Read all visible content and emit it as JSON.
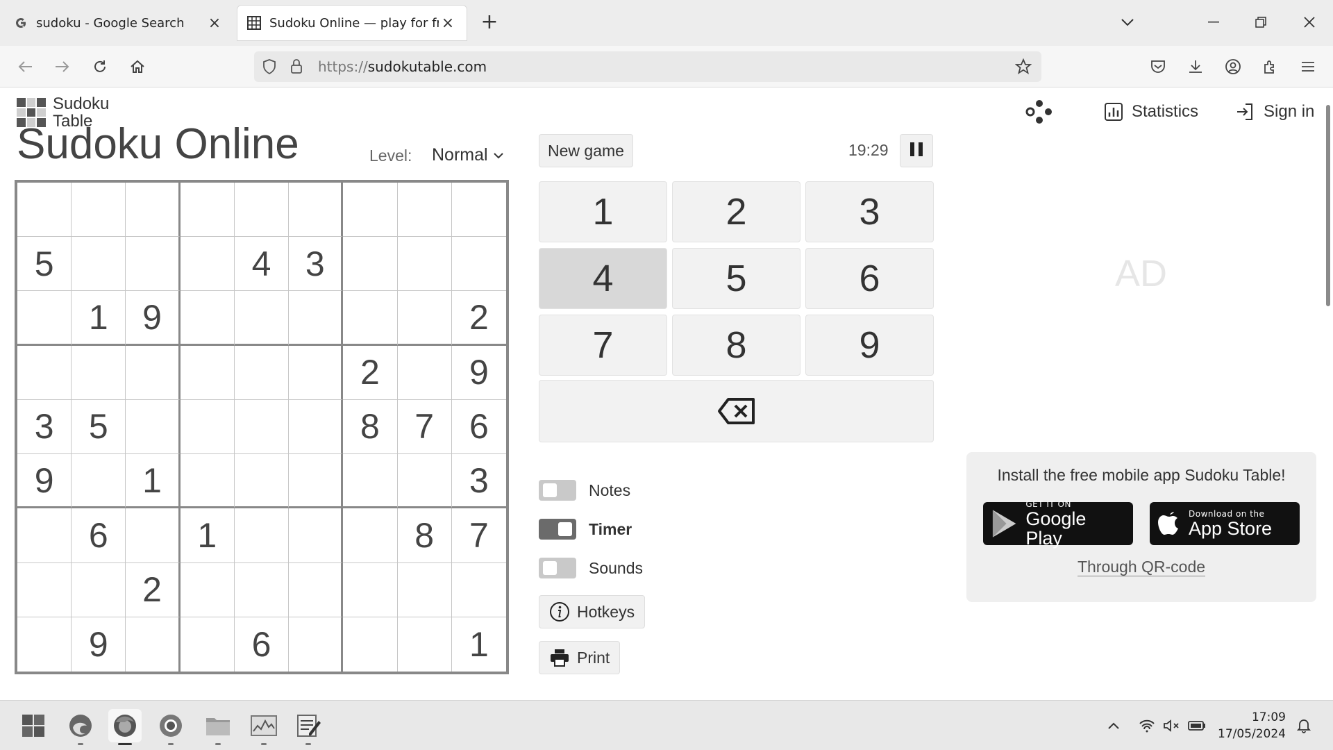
{
  "browser": {
    "tabs": [
      {
        "title": "sudoku - Google Search",
        "favicon": "google-g-icon"
      },
      {
        "title": "Sudoku Online — play for free online",
        "favicon": "sudoku-grid-icon"
      }
    ],
    "url_protocol": "https://",
    "url_host": "sudokutable.com"
  },
  "site": {
    "logo_line1": "Sudoku",
    "logo_line2": "Table",
    "nav": {
      "statistics": "Statistics",
      "signin": "Sign in"
    }
  },
  "game": {
    "title": "Sudoku Online",
    "level_label": "Level:",
    "level_value": "Normal",
    "new_game": "New game",
    "timer": "19:29",
    "grid": [
      [
        "",
        "",
        "",
        "",
        "",
        "",
        "",
        "",
        ""
      ],
      [
        "5",
        "",
        "",
        "",
        "4",
        "3",
        "",
        "",
        ""
      ],
      [
        "",
        "1",
        "9",
        "",
        "",
        "",
        "",
        "",
        "2"
      ],
      [
        "",
        "",
        "",
        "",
        "",
        "",
        "2",
        "",
        "9"
      ],
      [
        "3",
        "5",
        "",
        "",
        "",
        "",
        "8",
        "7",
        "6"
      ],
      [
        "9",
        "",
        "1",
        "",
        "",
        "",
        "",
        "",
        "3"
      ],
      [
        "",
        "6",
        "",
        "1",
        "",
        "",
        "",
        "8",
        "7"
      ],
      [
        "",
        "",
        "2",
        "",
        "",
        "",
        "",
        "",
        ""
      ],
      [
        "",
        "9",
        "",
        "",
        "6",
        "",
        "",
        "",
        "1"
      ]
    ],
    "numpad": [
      "1",
      "2",
      "3",
      "4",
      "5",
      "6",
      "7",
      "8",
      "9"
    ],
    "selected_number": "4",
    "toggles": [
      {
        "label": "Notes",
        "on": false
      },
      {
        "label": "Timer",
        "on": true
      },
      {
        "label": "Sounds",
        "on": false
      }
    ],
    "hotkeys": "Hotkeys",
    "print": "Print"
  },
  "ad": {
    "label": "AD"
  },
  "promo": {
    "text": "Install the free mobile app Sudoku Table!",
    "google_small": "GET IT ON",
    "google_big": "Google Play",
    "apple_small": "Download on the",
    "apple_big": "App Store",
    "qr_link": "Through QR-code"
  },
  "taskbar": {
    "time": "17:09",
    "date": "17/05/2024"
  }
}
